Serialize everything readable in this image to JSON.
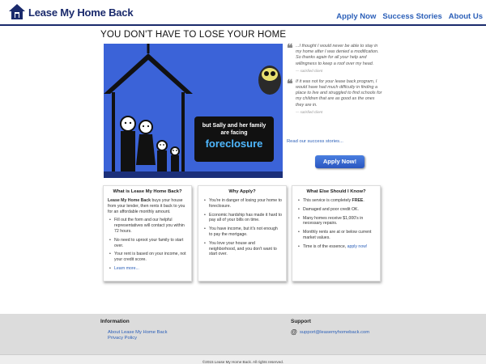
{
  "header": {
    "logo_text": "Lease My Home Back",
    "nav": [
      "Apply Now",
      "Success Stories",
      "About Us"
    ]
  },
  "main": {
    "title": "YOU DON'T HAVE TO LOSE YOUR HOME",
    "hero": {
      "sign_line1": "but Sally and her family",
      "sign_line2": "are facing",
      "sign_line3": "foreclosure"
    },
    "testimonials": [
      {
        "text": "...I thought I would never be able to stay in my home after I was denied a modification. So thanks again for all your help and willingness to keep a roof over my head.",
        "source": "— satisfied client"
      },
      {
        "text": "If it was not for your lease back program, I would have had much difficulty in finding a place to live and struggled to find schools for my children that are as good as the ones they are in.",
        "source": "— satisfied client"
      }
    ],
    "success_link": "Read our success stories...",
    "apply_button": "Apply Now!"
  },
  "cards": {
    "what": {
      "title": "What is Lease My Home Back?",
      "intro_bold": "Lease My Home Back",
      "intro_rest": " buys your house from your lender, then rents it back to you for an affordable monthly amount.",
      "items": [
        "Fill out the form and our helpful representatives will contact you within 72 hours.",
        "No need to uproot your family to start over.",
        "Your rent is based on your income, not your credit score."
      ],
      "more_link": "Learn more..."
    },
    "why": {
      "title": "Why Apply?",
      "items": [
        "You're in danger of losing your home to foreclosure.",
        "Economic hardship has made it hard to pay all of your bills on time.",
        "You have income, but it's not enough to pay the mortgage.",
        "You love your house and neighborhood, and you don't want to start over."
      ]
    },
    "else": {
      "title": "What Else Should I Know?",
      "item1_pre": "This service is completely ",
      "item1_bold": "FREE",
      "item1_post": ".",
      "item2": "Damaged and poor credit OK.",
      "item3": "Many homes receive $1,000's in necessary repairs.",
      "item4": "Monthly rents are at or below current market values.",
      "item5_pre": "Time is of the essence, ",
      "item5_link": "apply now!"
    }
  },
  "footer": {
    "info_heading": "Information",
    "info_links": [
      "About Lease My Home Back",
      "Privacy Policy"
    ],
    "support_heading": "Support",
    "support_email": "support@leasemyhomeback.com",
    "copyright": "©2015 Lease My Home Back. All rights reserved."
  },
  "colors": {
    "brand_navy": "#1a2a6c",
    "link_blue": "#2b5fb8",
    "hero_blue": "#3b63d8",
    "footer_gray": "#dcdcdc"
  }
}
